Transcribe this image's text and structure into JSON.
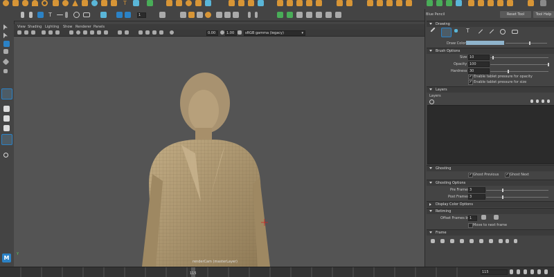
{
  "colors": {
    "maya_blue": "#2b82c6",
    "shelf_orange": "#d79536",
    "shelf_blue": "#5ab6d8",
    "shelf_green": "#49ad58"
  },
  "top_toolbar": {
    "frame_field": "1"
  },
  "viewport": {
    "menu": [
      "View",
      "Shading",
      "Lighting",
      "Show",
      "Renderer",
      "Panels"
    ],
    "field_a": "0.00",
    "field_b": "1.00",
    "color_space": "sRGB gamma (legacy)",
    "camera_label": "renderCam (masterLayer)",
    "axis_label": "Y"
  },
  "logo": "M",
  "right_panel": {
    "title": "Blue Pencil",
    "reset_tool": "Reset Tool",
    "tool_help": "Tool Help",
    "sections": {
      "drawing": "Drawing",
      "brush_options": "Brush Options",
      "layers": "Layers",
      "ghosting": "Ghosting",
      "ghosting_options": "Ghosting Options",
      "display_color_options": "Display Color Options",
      "retiming": "Retiming",
      "frame": "Frame"
    },
    "draw_color_label": "Draw Color:",
    "draw_color": "#8fb4cc",
    "size_label": "Size",
    "size_value": "10",
    "opacity_label": "Opacity",
    "opacity_value": "100",
    "hardness_label": "Hardness",
    "hardness_value": "30",
    "opt_pressure_opacity": "Enable tablet pressure for opacity",
    "opt_pressure_size": "Enable tablet pressure for size",
    "layers_sub": "Layers",
    "ghost_previous": "Ghost Previous",
    "ghost_next": "Ghost Next",
    "pre_frames_label": "Pre Frames",
    "pre_frames_value": "3",
    "post_frames_label": "Post Frames",
    "post_frames_value": "3",
    "offset_frames_label": "Offset Frames by:",
    "offset_frames_value": "1",
    "move_to_next": "Move to next frame"
  },
  "timeline": {
    "current_frame": "115",
    "frame_field": "115"
  }
}
